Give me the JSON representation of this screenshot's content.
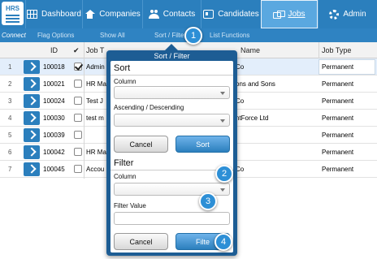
{
  "logo": {
    "text": "HRS"
  },
  "nav": {
    "tabs": [
      {
        "label": "Dashboard",
        "icon": "dashboard-icon"
      },
      {
        "label": "Companies",
        "icon": "house-icon"
      },
      {
        "label": "Contacts",
        "icon": "people-icon"
      },
      {
        "label": "Candidates",
        "icon": "card-icon"
      },
      {
        "label": "Jobs",
        "icon": "jobs-icon",
        "active": true
      },
      {
        "label": "Admin",
        "icon": "gear-icon"
      }
    ]
  },
  "subnav": {
    "connect": "Connect",
    "flag_options": "Flag Options",
    "show_all": "Show All",
    "sort_filter": "Sort / Filter",
    "list_functions": "List Functions"
  },
  "table": {
    "headers": {
      "id": "ID",
      "check": "✔",
      "job": "Job T",
      "company": "Name",
      "type": "Job Type"
    },
    "rows": [
      {
        "num": "1",
        "id": "100018",
        "checked": true,
        "job": "Admin",
        "company": "Co",
        "type": "Permanent"
      },
      {
        "num": "2",
        "id": "100021",
        "checked": false,
        "job": "HR Ma",
        "company": "ons and Sons",
        "type": "Permanent"
      },
      {
        "num": "3",
        "id": "100024",
        "checked": false,
        "job": "Test J",
        "company": "Co",
        "type": "Permanent"
      },
      {
        "num": "4",
        "id": "100030",
        "checked": false,
        "job": "test m",
        "company": "ntForce Ltd",
        "type": "Permanent"
      },
      {
        "num": "5",
        "id": "100039",
        "checked": false,
        "job": "",
        "company": "",
        "type": "Permanent"
      },
      {
        "num": "6",
        "id": "100042",
        "checked": false,
        "job": "HR Ma",
        "company": "",
        "type": "Permanent"
      },
      {
        "num": "7",
        "id": "100045",
        "checked": false,
        "job": "Accou",
        "company": "Co",
        "type": "Permanent"
      }
    ]
  },
  "popup": {
    "title": "Sort / Filter",
    "sort": {
      "heading": "Sort",
      "column_label": "Column",
      "order_label": "Ascending / Descending",
      "cancel": "Cancel",
      "submit": "Sort"
    },
    "filter": {
      "heading": "Filter",
      "column_label": "Column",
      "value_label": "Filter Value",
      "cancel": "Cancel",
      "submit": "Filte"
    }
  },
  "steps": [
    "1",
    "2",
    "3",
    "4"
  ],
  "colors": {
    "nav": "#2b7fbd",
    "popup": "#1d5d94",
    "accent": "#2d8fd6"
  }
}
